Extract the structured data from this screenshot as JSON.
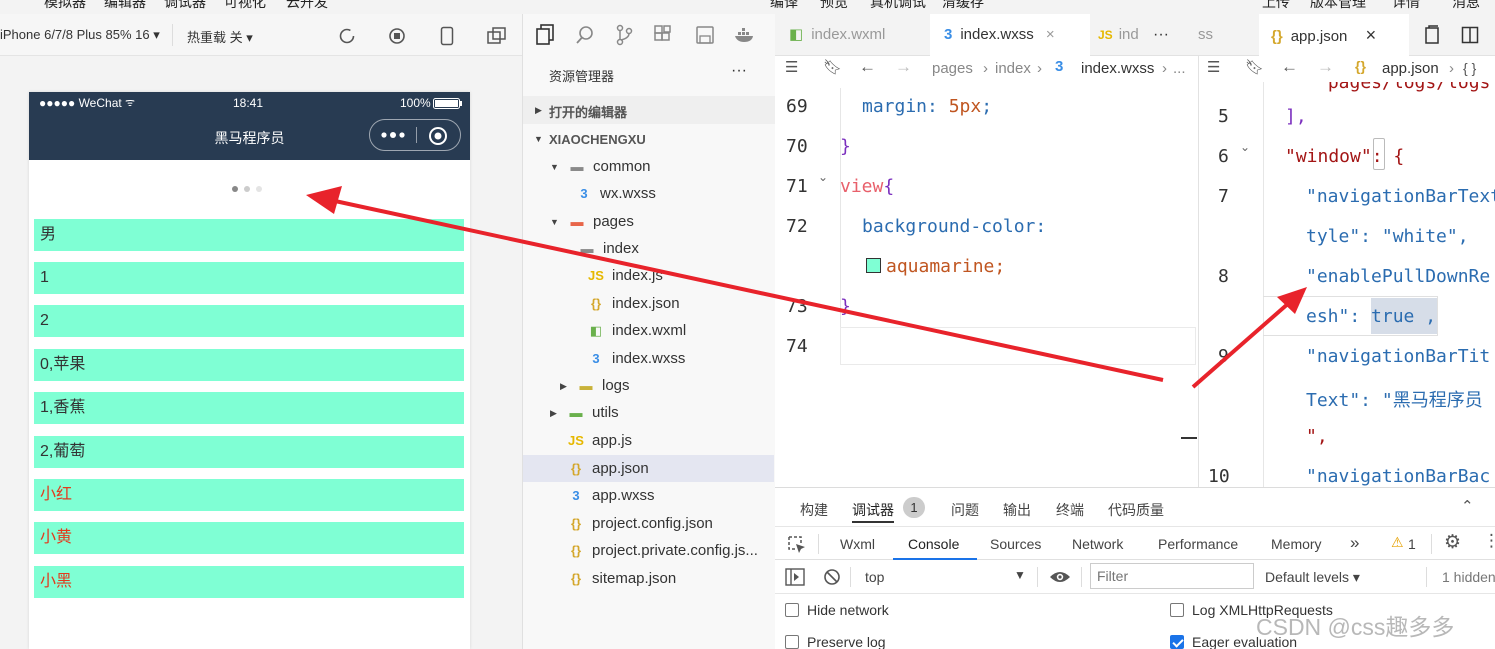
{
  "menu": [
    "模拟器",
    "编辑器",
    "调试器",
    "可视化",
    "云开发",
    "编译",
    "预览",
    "真机调试",
    "清缓存",
    "上传",
    "版本管理",
    "详情",
    "消息"
  ],
  "simulator": {
    "device": "iPhone 6/7/8 Plus 85% 16 ▾",
    "hot_reload": "热重载 关 ▾",
    "status_carrier": "●●●●● WeChat",
    "status_time": "18:41",
    "status_battery": "100%",
    "nav_title": "黑马程序员",
    "items": [
      "男",
      "1",
      "2",
      "0,苹果",
      "1,香蕉",
      "2,葡萄",
      "小红",
      "小黄",
      "小黑"
    ]
  },
  "explorer": {
    "title": "资源管理器",
    "more": "···",
    "open_editors": "打开的编辑器",
    "project": "XIAOCHENGXU",
    "tree": [
      {
        "label": "common",
        "icon": "folder-icon"
      },
      {
        "label": "wx.wxss",
        "icon": "css-file-icon"
      },
      {
        "label": "pages",
        "icon": "folder-icon"
      },
      {
        "label": "index",
        "icon": "folder-icon"
      },
      {
        "label": "index.js",
        "icon": "js-file-icon"
      },
      {
        "label": "index.json",
        "icon": "json-file-icon"
      },
      {
        "label": "index.wxml",
        "icon": "wxml-file-icon"
      },
      {
        "label": "index.wxss",
        "icon": "css-file-icon"
      },
      {
        "label": "logs",
        "icon": "folder-icon"
      },
      {
        "label": "utils",
        "icon": "folder-icon"
      },
      {
        "label": "app.js",
        "icon": "js-file-icon"
      },
      {
        "label": "app.json",
        "icon": "json-file-icon"
      },
      {
        "label": "app.wxss",
        "icon": "css-file-icon"
      },
      {
        "label": "project.config.json",
        "icon": "json-file-icon"
      },
      {
        "label": "project.private.config.js...",
        "icon": "json-file-icon"
      },
      {
        "label": "sitemap.json",
        "icon": "json-file-icon"
      }
    ]
  },
  "editor_tabs": {
    "t1": "index.wxml",
    "t2": "index.wxss",
    "t3a": "ind",
    "t3b": "ss",
    "more": "···",
    "t4": "app.json",
    "close": "×"
  },
  "left_editor": {
    "breadcrumb": [
      "pages",
      "index",
      "index.wxss",
      "..."
    ],
    "lines": [
      {
        "n": "69",
        "code": "margin: 5px;"
      },
      {
        "n": "70",
        "code": "}"
      },
      {
        "n": "71",
        "code": "view{"
      },
      {
        "n": "72",
        "code": "background-color:"
      },
      {
        "n": "",
        "code": "aquamarine;"
      },
      {
        "n": "73",
        "code": "}"
      },
      {
        "n": "74",
        "code": ""
      }
    ]
  },
  "right_editor": {
    "breadcrumb": [
      "app.json",
      "{ }"
    ],
    "lines": [
      {
        "n": "5",
        "code": "],"
      },
      {
        "n": "6",
        "code": "\"window\": {"
      },
      {
        "n": "7",
        "code": "\"navigationBarText"
      },
      {
        "n": "",
        "code": "tyle\": \"white\","
      },
      {
        "n": "8",
        "code": "\"enablePullDownRe"
      },
      {
        "n": "",
        "code": "esh\": true ,"
      },
      {
        "n": "9",
        "code": "\"navigationBarTit"
      },
      {
        "n": "",
        "code": "Text\": \"黑马程序员"
      },
      {
        "n": "",
        "code": "\","
      },
      {
        "n": "10",
        "code": "\"navigationBarBac"
      }
    ]
  },
  "panel": {
    "tabs": [
      "构建",
      "调试器",
      "问题",
      "输出",
      "终端",
      "代码质量"
    ],
    "badge": "1",
    "devtools_tabs": [
      "Wxml",
      "Console",
      "Sources",
      "Network",
      "Performance",
      "Memory"
    ],
    "chevrons": "»",
    "warning_count": "1",
    "context": "top",
    "filter_placeholder": "Filter",
    "levels": "Default levels ▾",
    "hidden": "1 hidden",
    "options": {
      "hide_network": "Hide network",
      "preserve_log": "Preserve log",
      "log_xhr": "Log XMLHttpRequests",
      "eager_eval": "Eager evaluation"
    }
  },
  "watermark": "CSDN @css趣多多",
  "colors": {
    "nav": "#283b52",
    "cell": "aquamarine",
    "red_text": "#e23b1e",
    "arrow": "#e8232b",
    "accent": "#1a73e8"
  }
}
